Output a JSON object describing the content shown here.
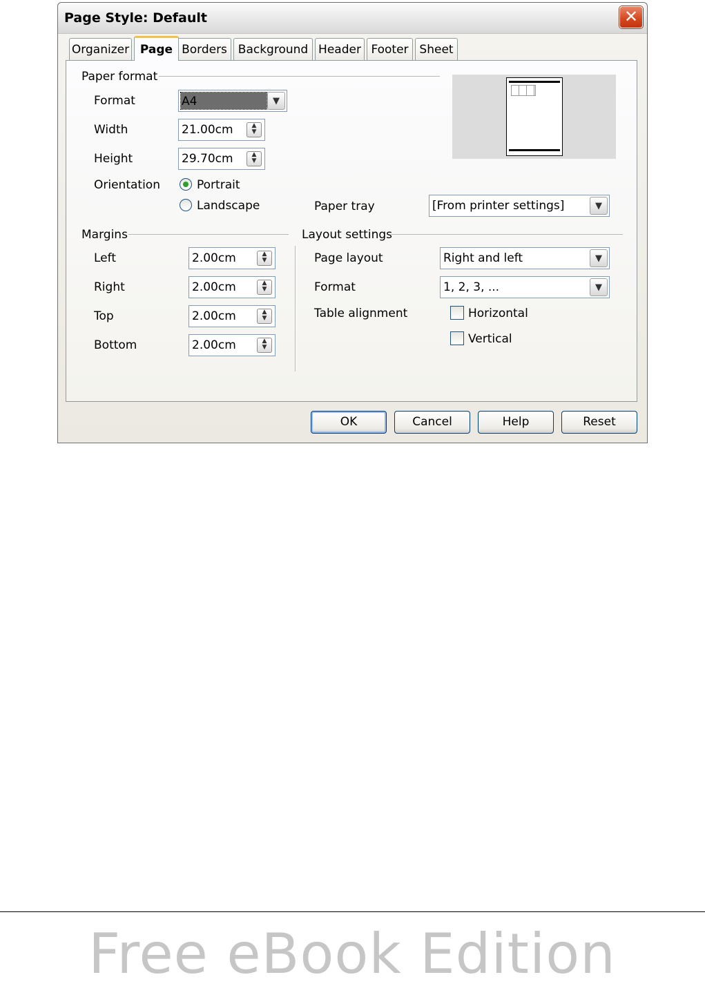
{
  "dialog": {
    "title": "Page Style: Default",
    "close_glyph": "✕"
  },
  "tabs": [
    {
      "label": "Organizer"
    },
    {
      "label": "Page",
      "active": true
    },
    {
      "label": "Borders"
    },
    {
      "label": "Background"
    },
    {
      "label": "Header"
    },
    {
      "label": "Footer"
    },
    {
      "label": "Sheet"
    }
  ],
  "paper_format": {
    "section_label": "Paper format",
    "format_label": "Format",
    "format_value": "A4",
    "width_label": "Width",
    "width_value": "21.00cm",
    "height_label": "Height",
    "height_value": "29.70cm",
    "orientation_label": "Orientation",
    "portrait_label": "Portrait",
    "landscape_label": "Landscape",
    "selected_orientation": "Portrait",
    "paper_tray_label": "Paper tray",
    "paper_tray_value": "[From printer settings]"
  },
  "margins": {
    "section_label": "Margins",
    "left_label": "Left",
    "left_value": "2.00cm",
    "right_label": "Right",
    "right_value": "2.00cm",
    "top_label": "Top",
    "top_value": "2.00cm",
    "bottom_label": "Bottom",
    "bottom_value": "2.00cm"
  },
  "layout_settings": {
    "section_label": "Layout settings",
    "page_layout_label": "Page layout",
    "page_layout_value": "Right and left",
    "format_label": "Format",
    "format_value": "1, 2, 3, ...",
    "table_alignment_label": "Table alignment",
    "horizontal_label": "Horizontal",
    "horizontal_checked": false,
    "vertical_label": "Vertical",
    "vertical_checked": false
  },
  "buttons": {
    "ok": "OK",
    "cancel": "Cancel",
    "help": "Help",
    "reset": "Reset"
  },
  "footer": {
    "text": "Free eBook Edition"
  },
  "colors": {
    "title_bar": "#e3e3e3",
    "close_button": "#d4461d",
    "active_tab_accent": "#f1c14a",
    "footer_text": "#c6c6c6"
  }
}
